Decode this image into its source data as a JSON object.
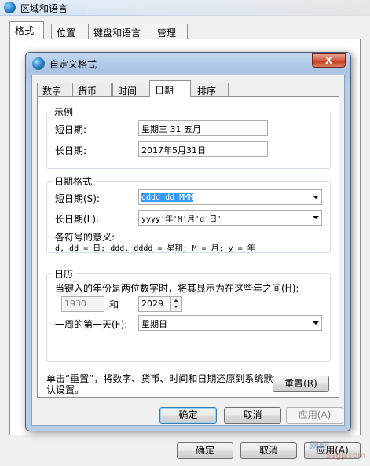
{
  "outer": {
    "title": "区域和语言",
    "tabs": [
      "格式",
      "位置",
      "键盘和语言",
      "管理"
    ],
    "ok_label": "确定",
    "cancel_label": "取消",
    "apply_label": "应用(A)"
  },
  "dialog": {
    "title": "自定义格式",
    "close_glyph": "X",
    "tabs": [
      "数字",
      "货币",
      "时间",
      "日期",
      "排序"
    ],
    "active_tab": "日期",
    "example": {
      "group_title": "示例",
      "short_label": "短日期:",
      "short_value": "星期三 31 五月",
      "long_label": "长日期:",
      "long_value": "2017年5月31日"
    },
    "formats": {
      "group_title": "日期格式",
      "short_label": "短日期(S):",
      "short_value": "dddd dd MMM",
      "long_label": "长日期(L):",
      "long_value": "yyyy'年'M'月'd'日'",
      "legend_title": "各符号的意义:",
      "legend_text": "d, dd = 日;  ddd, dddd = 星期;  M = 月;  y = 年"
    },
    "calendar": {
      "group_title": "日历",
      "two_digit_text": "当键入的年份是两位数字时，将其显示为在这些年之间(H):",
      "year_from": "1930",
      "and_label": "和",
      "year_to": "2029",
      "first_day_label": "一周的第一天(F):",
      "first_day_value": "星期日"
    },
    "reset_text": "单击“重置”，将数字、货币、时间和日期还原到系统默认设置。",
    "reset_label": "重置(R)",
    "ok_label": "确定",
    "cancel_label": "取消",
    "apply_label": "应用(A)"
  },
  "watermark": {
    "text": "网吧",
    "url": "59gp.com"
  }
}
